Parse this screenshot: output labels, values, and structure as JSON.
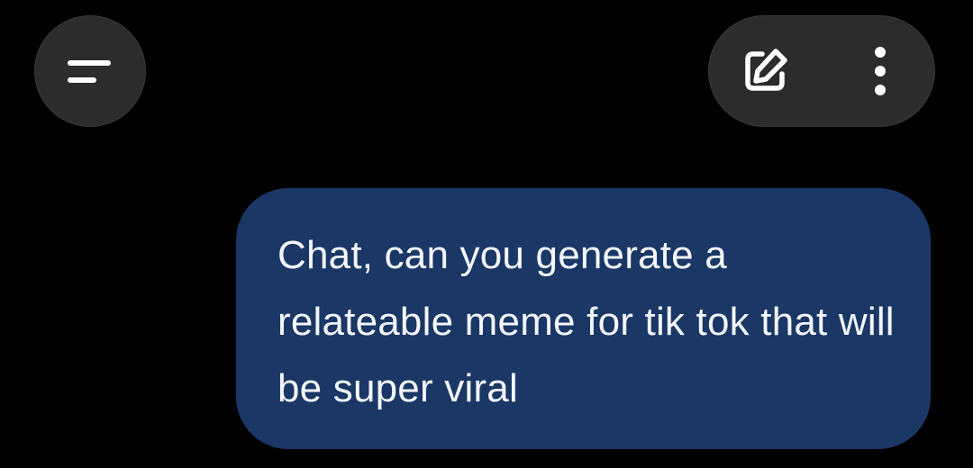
{
  "toolbar": {
    "menu_icon": "menu-icon",
    "new_chat_icon": "edit-icon",
    "more_icon": "more-vertical-icon"
  },
  "chat": {
    "messages": [
      {
        "role": "user",
        "text": "Chat, can you generate a relateable meme for tik tok that will be super viral"
      }
    ]
  },
  "colors": {
    "background": "#000000",
    "button_bg": "#2c2c2c",
    "user_bubble": "#1a3766",
    "icon": "#ffffff"
  }
}
